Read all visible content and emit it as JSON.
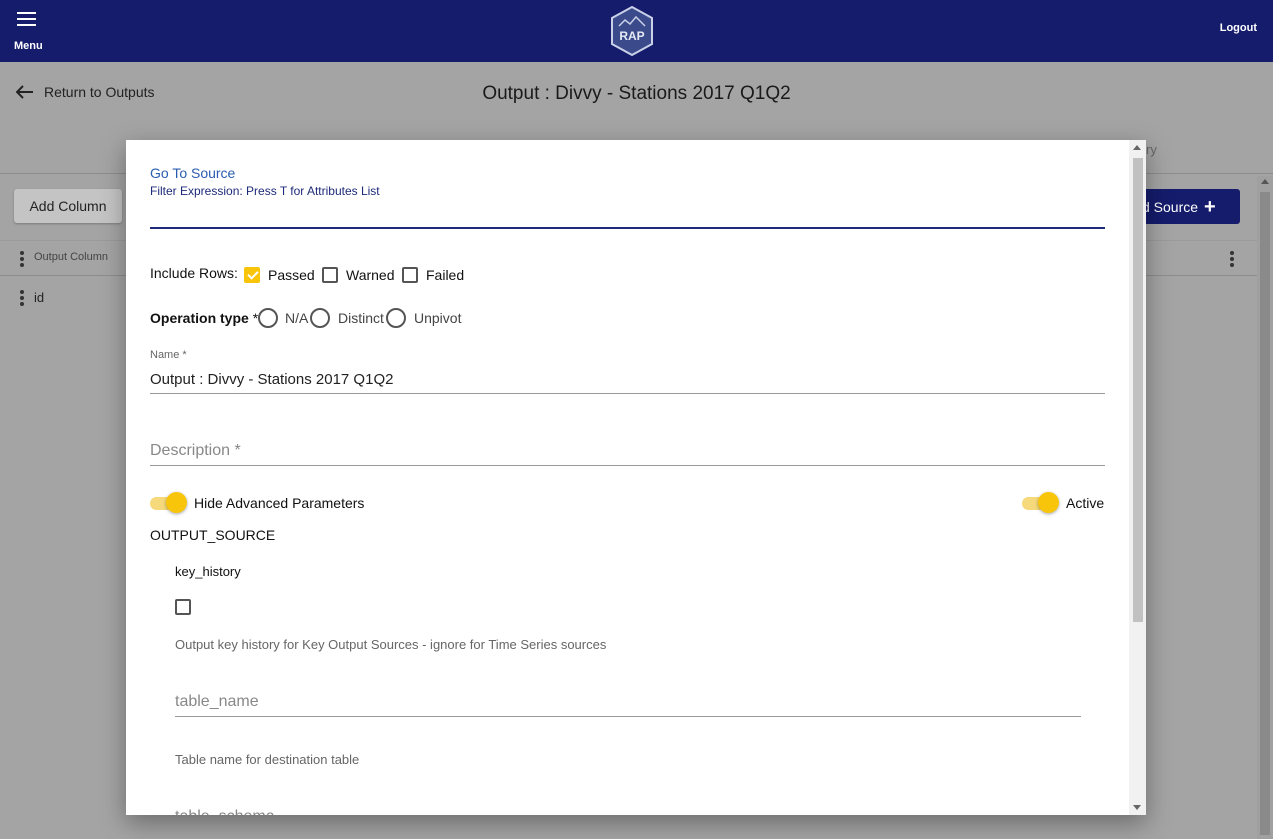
{
  "appbar": {
    "menu_label": "Menu",
    "logo_text": "RAP",
    "logout_label": "Logout"
  },
  "page": {
    "return_label": "Return to Outputs",
    "title": "Output : Divvy - Stations 2017 Q1Q2",
    "history_tab_partial": "ry",
    "add_column_label": "Add Column",
    "add_source_label": "d Source",
    "grid": {
      "column_header": "Output Column",
      "rows": [
        "id"
      ]
    }
  },
  "modal": {
    "goto_source": "Go To Source",
    "filter_label": "Filter Expression: Press T for Attributes List",
    "filter_value": "",
    "include_rows_label": "Include Rows:",
    "include_rows": [
      {
        "label": "Passed",
        "checked": true
      },
      {
        "label": "Warned",
        "checked": false
      },
      {
        "label": "Failed",
        "checked": false
      }
    ],
    "operation_type_label": "Operation type",
    "operation_type_required": "*",
    "operation_types": [
      "N/A",
      "Distinct",
      "Unpivot"
    ],
    "name_label": "Name *",
    "name_value": "Output : Divvy - Stations 2017 Q1Q2",
    "description_placeholder": "Description *",
    "hide_advanced_label": "Hide Advanced Parameters",
    "active_label": "Active",
    "output_source_heading": "OUTPUT_SOURCE",
    "key_history_label": "key_history",
    "key_history_checked": false,
    "key_history_hint": "Output key history for Key Output Sources - ignore for Time Series sources",
    "table_name_placeholder": "table_name",
    "table_name_hint": "Table name for destination table",
    "table_schema_placeholder": "table_schema"
  },
  "colors": {
    "appbar": "#151c6b",
    "accent": "#f9c50b",
    "link": "#2a5db0"
  }
}
